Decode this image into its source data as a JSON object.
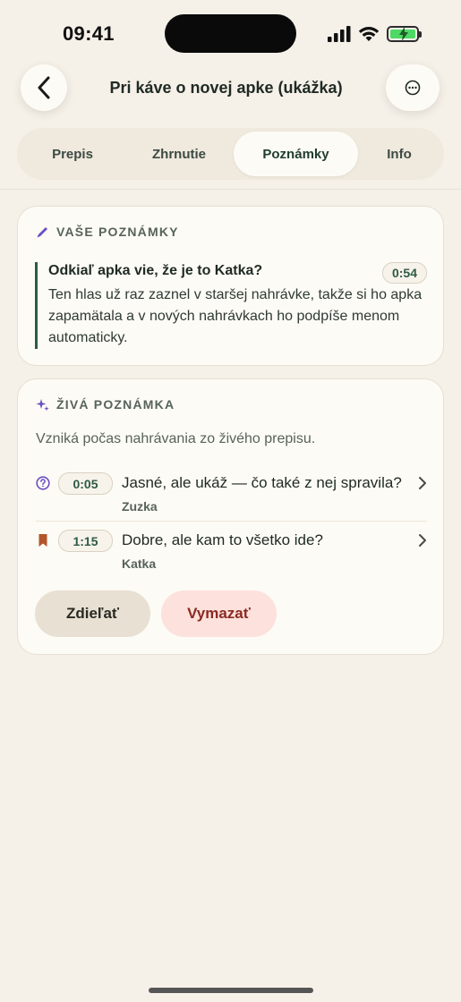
{
  "status_bar": {
    "time": "09:41"
  },
  "header": {
    "title": "Pri káve o novej apke (ukážka)"
  },
  "tabs": [
    {
      "label": "Prepis"
    },
    {
      "label": "Zhrnutie"
    },
    {
      "label": "Poznámky",
      "selected": true
    },
    {
      "label": "Info"
    }
  ],
  "notes_card": {
    "label": "VAŠE POZNÁMKY",
    "note": {
      "title": "Odkiaľ apka vie, že je to Katka?",
      "time": "0:54",
      "body": "Ten hlas už raz zaznel v staršej nahrávke, takže si ho apka zapamätala a v nových nahrávkach ho podpíše menom automaticky."
    }
  },
  "live_card": {
    "label": "ŽIVÁ POZNÁMKA",
    "subtitle": "Vzniká počas nahrávania zo živého prepisu.",
    "items": [
      {
        "icon": "question-icon",
        "time": "0:05",
        "text": "Jasné, ale ukáž — čo také z nej spravila?",
        "speaker": "Zuzka"
      },
      {
        "icon": "bookmark-icon",
        "time": "1:15",
        "text": "Dobre, ale kam to všetko ide?",
        "speaker": "Katka"
      }
    ],
    "share_label": "Zdieľať",
    "delete_label": "Vymazať"
  },
  "colors": {
    "background": "#f5f0e8",
    "card": "#fdfbf5",
    "accent_green": "#2e5a44",
    "accent_purple": "#6a4fc2",
    "bookmark": "#b2552a",
    "delete_text": "#8a2a22",
    "delete_bg": "#fde1dc"
  }
}
